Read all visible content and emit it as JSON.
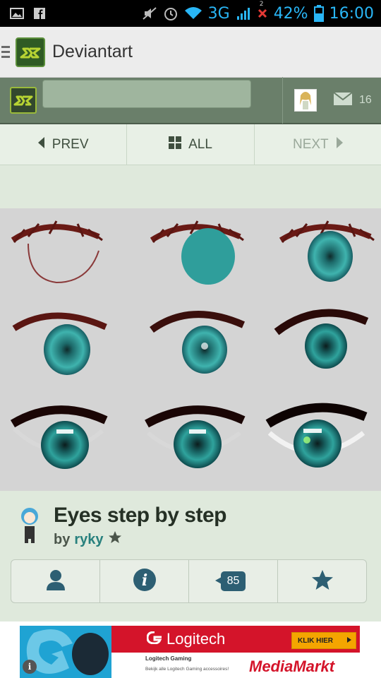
{
  "status_bar": {
    "network": "3G",
    "battery": "42%",
    "time": "16:00",
    "notification_count": "2"
  },
  "app": {
    "title": "Deviantart"
  },
  "toolbar": {
    "search_placeholder": "",
    "message_count": "16"
  },
  "nav": {
    "prev": "PREV",
    "all": "ALL",
    "next": "NEXT"
  },
  "artwork": {
    "title": "Eyes step by step",
    "by_label": "by",
    "author": "ryky",
    "comment_count": "85"
  },
  "ad": {
    "brand": "Logitech",
    "cta": "KLIK HIER",
    "line1": "Logitech Gaming",
    "line2": "Bekijk alle Logitech Gaming accessoires!",
    "retailer": "MediaMarkt"
  },
  "colors": {
    "accent_green": "#9aba3b",
    "toolbar_green": "#6a7f6a",
    "link_teal": "#27807d",
    "status_blue": "#29b6f6"
  }
}
